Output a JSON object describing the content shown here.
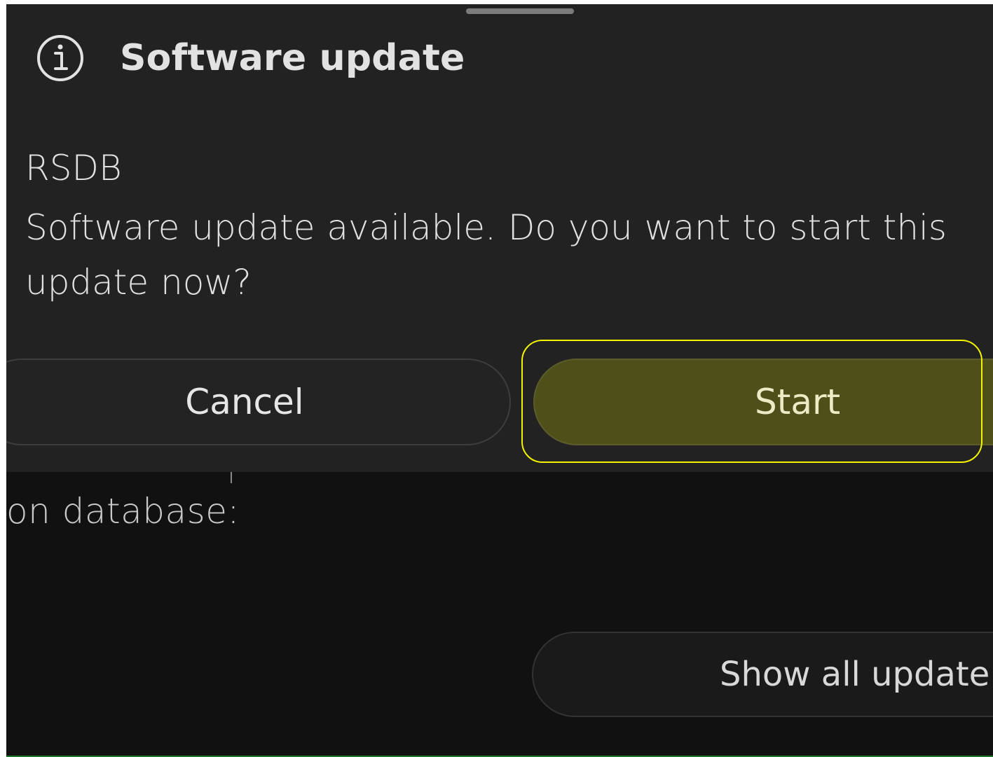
{
  "dialog": {
    "title": "Software update",
    "app_name": "RSDB",
    "message": "Software update available. Do you want to start this update now?",
    "cancel_label": "Cancel",
    "start_label": "Start",
    "icon": "info-icon"
  },
  "background": {
    "text": "on database:",
    "button_label": "Show all update"
  },
  "colors": {
    "sheet": "#222222",
    "background": "#111111",
    "start_button": "#4f4f19",
    "highlight": "#f4f400"
  }
}
